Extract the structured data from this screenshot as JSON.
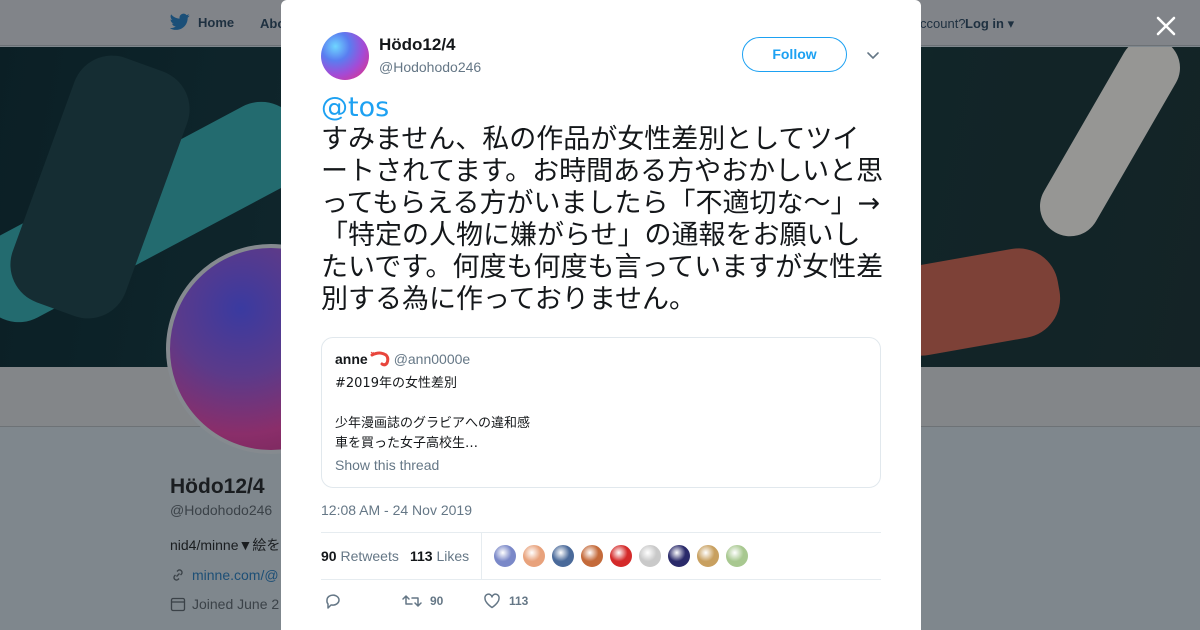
{
  "background_page": {
    "nav": {
      "home_label": "Home",
      "about_label": "Abo",
      "account_label": "ccount?",
      "login_label": "Log in"
    },
    "profile": {
      "name": "Hödo12/4",
      "handle": "@Hodohodo246",
      "bio": "nid4/minne▼絵を",
      "link": "minne.com/@",
      "joined": "Joined June 2"
    }
  },
  "tweet": {
    "author_name": "Hödo12/4",
    "author_handle": "@Hodohodo246",
    "follow_label": "Follow",
    "mention": "@tos",
    "text": "すみません、私の作品が女性差別としてツイートされてます。お時間ある方やおかしいと思ってもらえる方がいましたら「不適切な〜」→「特定の人物に嫌がらせ」の通報をお願いしたいです。何度も何度も言っていますが女性差別する為に作っておりません。",
    "quoted": {
      "name": "anne",
      "handle": "@ann0000e",
      "text": "#2019年の女性差別\n\n少年漫画誌のグラビアへの違和感\n車を買った女子高校生…",
      "thread_label": "Show this thread"
    },
    "timestamp": "12:08 AM - 24 Nov 2019",
    "retweets_count": "90",
    "retweets_label": "Retweets",
    "likes_count": "113",
    "likes_label": "Likes",
    "action_retweets": "90",
    "action_likes": "113",
    "liker_avatars": [
      "#7a88c8",
      "#e8a27c",
      "#4a6a9a",
      "#c46a3a",
      "#d42a2a",
      "#c9c9c9",
      "#2a2a6a",
      "#c8a060",
      "#a8c890"
    ]
  },
  "colors": {
    "accent": "#1da1f2",
    "text_primary": "#14171a",
    "text_secondary": "#657786"
  }
}
